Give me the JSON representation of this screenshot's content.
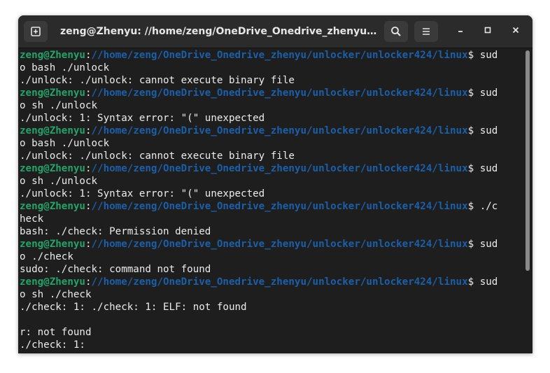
{
  "window": {
    "title": "zeng@Zhenyu: //home/zeng/OneDrive_Onedrive_zhenyu/unlocke..."
  },
  "icons": {
    "new_tab": "new-tab-icon",
    "search": "search-icon",
    "menu": "hamburger-menu-icon",
    "minimize": "minimize-icon",
    "maximize": "maximize-icon",
    "close": "close-icon"
  },
  "colors": {
    "background": "#1e1e1e",
    "titlebar": "#2b2b2b",
    "prompt_user": "#26a269",
    "prompt_path": "#1c5fa8",
    "text": "#ececec"
  },
  "terminal": {
    "lines": [
      {
        "user": "zeng@Zhenyu",
        "sep": ":",
        "path": "//home/zeng/OneDrive_Onedrive_zhenyu/unlocker/unlocker424/linux",
        "cmd": "$ sud"
      },
      {
        "text": "o bash ./unlock"
      },
      {
        "text": "./unlock: ./unlock: cannot execute binary file"
      },
      {
        "user": "zeng@Zhenyu",
        "sep": ":",
        "path": "//home/zeng/OneDrive_Onedrive_zhenyu/unlocker/unlocker424/linux",
        "cmd": "$ sud"
      },
      {
        "text": "o sh ./unlock"
      },
      {
        "text": "./unlock: 1: Syntax error: \"(\" unexpected"
      },
      {
        "user": "zeng@Zhenyu",
        "sep": ":",
        "path": "//home/zeng/OneDrive_Onedrive_zhenyu/unlocker/unlocker424/linux",
        "cmd": "$ sud"
      },
      {
        "text": "o bash ./unlock"
      },
      {
        "text": "./unlock: ./unlock: cannot execute binary file"
      },
      {
        "user": "zeng@Zhenyu",
        "sep": ":",
        "path": "//home/zeng/OneDrive_Onedrive_zhenyu/unlocker/unlocker424/linux",
        "cmd": "$ sud"
      },
      {
        "text": "o sh ./unlock"
      },
      {
        "text": "./unlock: 1: Syntax error: \"(\" unexpected"
      },
      {
        "user": "zeng@Zhenyu",
        "sep": ":",
        "path": "//home/zeng/OneDrive_Onedrive_zhenyu/unlocker/unlocker424/linux",
        "cmd": "$ ./c"
      },
      {
        "text": "heck"
      },
      {
        "text": "bash: ./check: Permission denied"
      },
      {
        "user": "zeng@Zhenyu",
        "sep": ":",
        "path": "//home/zeng/OneDrive_Onedrive_zhenyu/unlocker/unlocker424/linux",
        "cmd": "$ sud"
      },
      {
        "text": "o ./check"
      },
      {
        "text": "sudo: ./check: command not found"
      },
      {
        "user": "zeng@Zhenyu",
        "sep": ":",
        "path": "//home/zeng/OneDrive_Onedrive_zhenyu/unlocker/unlocker424/linux",
        "cmd": "$ sud"
      },
      {
        "text": "o sh ./check"
      },
      {
        "text": "./check: 1: ./check: 1: ELF: not found"
      },
      {
        "text": ""
      },
      {
        "text": "r: not found"
      },
      {
        "text": "./check: 1:"
      }
    ]
  }
}
